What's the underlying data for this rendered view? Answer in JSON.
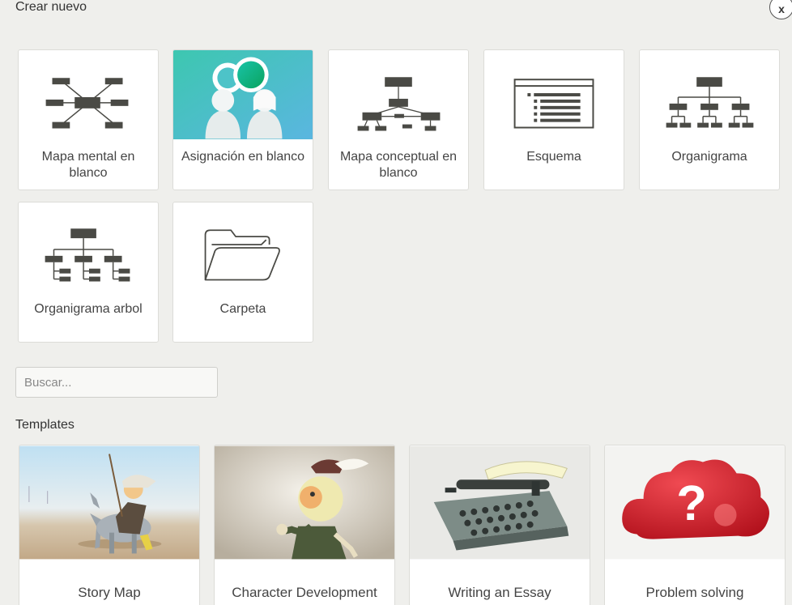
{
  "dialog": {
    "title": "Crear nuevo",
    "close_label": "x"
  },
  "blank_items": [
    {
      "label": "Mapa mental en blanco",
      "icon": "mind-map-icon"
    },
    {
      "label": "Asignación en blanco",
      "icon": "assignment-image"
    },
    {
      "label": "Mapa conceptual en blanco",
      "icon": "concept-map-icon"
    },
    {
      "label": "Esquema",
      "icon": "outline-icon"
    },
    {
      "label": "Organigrama",
      "icon": "org-chart-icon"
    },
    {
      "label": "Organigrama arbol",
      "icon": "tree-org-chart-icon"
    },
    {
      "label": "Carpeta",
      "icon": "folder-icon"
    }
  ],
  "search": {
    "placeholder": "Buscar..."
  },
  "templates_section": {
    "title": "Templates",
    "items": [
      {
        "label": "Story Map",
        "image": "don-quixote-illustration"
      },
      {
        "label": "Character Development",
        "image": "shakespeare-character-illustration"
      },
      {
        "label": "Writing an Essay",
        "image": "typewriter-illustration"
      },
      {
        "label": "Problem solving",
        "image": "question-mark-cloud-illustration"
      }
    ]
  },
  "colors": {
    "icon_dark": "#4a4a45",
    "accent_teal": "#3fc4b8",
    "cloud_red": "#d9232e"
  }
}
